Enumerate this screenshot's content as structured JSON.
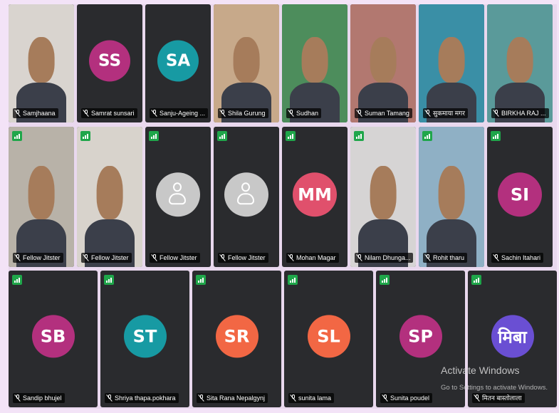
{
  "participants_row1": [
    {
      "name": "Samjhaana",
      "type": "video",
      "bg": "#d9d4cf"
    },
    {
      "name": "Samrat sunsari",
      "type": "avatar",
      "initials": "SS",
      "color": "#b3307e"
    },
    {
      "name": "Sanju-Ageing ...",
      "type": "avatar",
      "initials": "SA",
      "color": "#179aa3"
    },
    {
      "name": "Shila Gurung",
      "type": "video",
      "bg": "#c7a98a"
    },
    {
      "name": "Sudhan",
      "type": "video",
      "bg": "#4d8d5c"
    },
    {
      "name": "Suman Tamang",
      "type": "video",
      "bg": "#b27870"
    },
    {
      "name": "सुकमाया मगर",
      "type": "video",
      "bg": "#3a8fa6"
    },
    {
      "name": "BIRKHA RAJ ...",
      "type": "video",
      "bg": "#5a9a9a"
    }
  ],
  "participants_row2": [
    {
      "name": "Fellow Jitster",
      "type": "video",
      "bg": "#b8b2a8"
    },
    {
      "name": "Fellow Jitster",
      "type": "video",
      "bg": "#d8d3cc"
    },
    {
      "name": "Fellow Jitster",
      "type": "placeholder"
    },
    {
      "name": "Fellow Jitster",
      "type": "placeholder"
    },
    {
      "name": "Mohan Magar",
      "type": "avatar",
      "initials": "MM",
      "color": "#e0506c"
    },
    {
      "name": "Nilam Dhunga...",
      "type": "video",
      "bg": "#d6d4d4"
    },
    {
      "name": "Rohit tharu",
      "type": "video",
      "bg": "#8fb0c5"
    },
    {
      "name": "Sachin Itahari",
      "type": "avatar",
      "initials": "SI",
      "color": "#b3307e"
    }
  ],
  "participants_row3": [
    {
      "name": "Sandip bhujel",
      "type": "avatar",
      "initials": "SB",
      "color": "#b3307e"
    },
    {
      "name": "Shriya thapa.pokhara",
      "type": "avatar",
      "initials": "ST",
      "color": "#179aa3"
    },
    {
      "name": "Sita Rana Nepalgynj",
      "type": "avatar",
      "initials": "SR",
      "color": "#f26744"
    },
    {
      "name": "sunita lama",
      "type": "avatar",
      "initials": "SL",
      "color": "#f26744"
    },
    {
      "name": "Sunita poudel",
      "type": "avatar",
      "initials": "SP",
      "color": "#b3307e"
    },
    {
      "name": "मितन बास्तोलाला",
      "type": "avatar",
      "initials": "मिबा",
      "color": "#6a4fd3"
    }
  ],
  "watermark": {
    "title": "Activate Windows",
    "subtitle": "Go to Settings to activate Windows."
  }
}
